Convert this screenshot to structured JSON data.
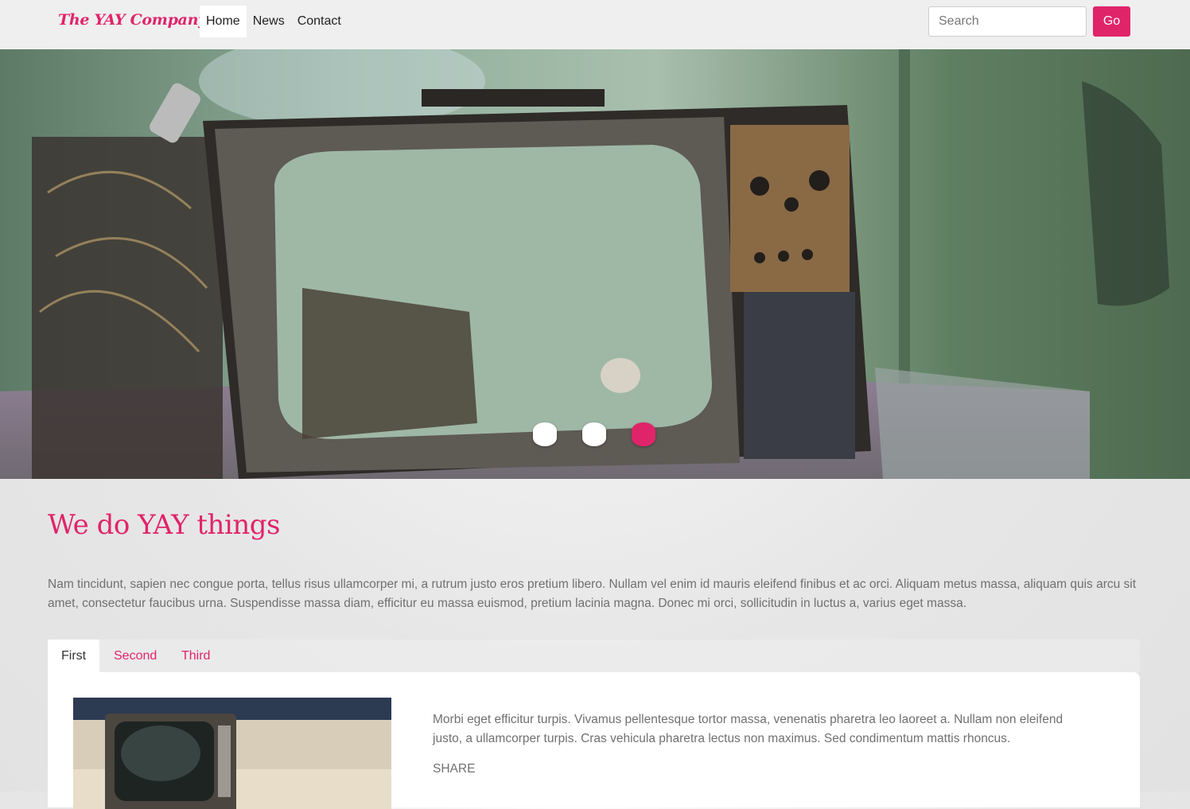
{
  "navbar": {
    "brand": "The YAY Company",
    "links": [
      {
        "label": "Home",
        "active": true
      },
      {
        "label": "News",
        "active": false
      },
      {
        "label": "Contact",
        "active": false
      }
    ],
    "search": {
      "placeholder": "Search",
      "value": ""
    },
    "go_label": "Go"
  },
  "hero": {
    "slide_count": 3,
    "active_slide": 3
  },
  "main": {
    "title": "We do YAY things",
    "intro": "Nam tincidunt, sapien nec congue porta, tellus risus ullamcorper mi, a rutrum justo eros pretium libero. Nullam vel enim id mauris eleifend finibus et ac orci. Aliquam metus massa, aliquam quis arcu sit amet, consectetur faucibus urna. Suspendisse massa diam, efficitur eu massa euismod, pretium lacinia magna. Donec mi orci, sollicitudin in luctus a, varius eget massa.",
    "tabs": [
      {
        "label": "First",
        "active": true
      },
      {
        "label": "Second",
        "active": false
      },
      {
        "label": "Third",
        "active": false
      }
    ],
    "panel": {
      "text": "Morbi eget efficitur turpis. Vivamus pellentesque tortor massa, venenatis pharetra leo laoreet a. Nullam non eleifend justo, a ullamcorper turpis. Cras vehicula pharetra lectus non maximus. Sed condimentum mattis rhoncus.",
      "share_label": "SHARE"
    }
  },
  "colors": {
    "accent": "#e0246a",
    "navbar_bg": "#efefef",
    "body_text": "#707070"
  }
}
